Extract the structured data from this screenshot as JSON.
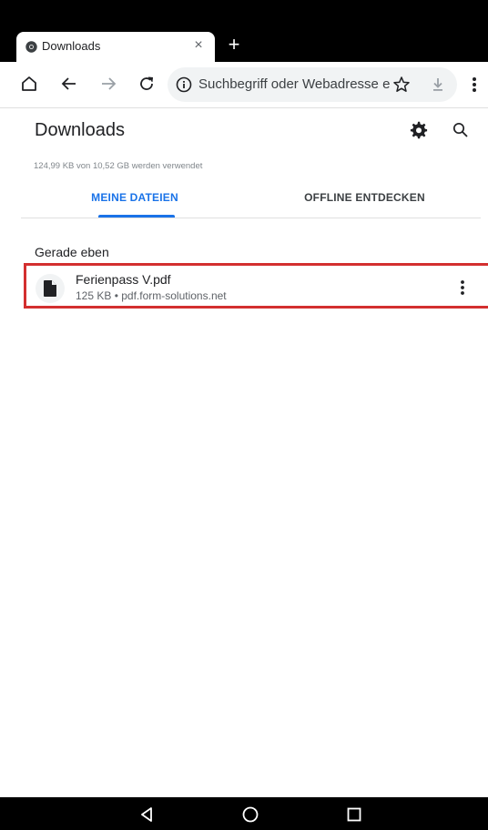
{
  "tab": {
    "title": "Downloads",
    "close_symbol": "×",
    "new_tab_symbol": "+"
  },
  "toolbar": {
    "home_icon": "home-icon",
    "back_icon": "back-arrow-icon",
    "forward_icon": "forward-arrow-icon",
    "reload_icon": "reload-icon",
    "omnibox_text": "Suchbegriff oder Webadresse ei",
    "menu_icon": "more-vert-icon"
  },
  "header": {
    "title": "Downloads",
    "settings_icon": "gear-icon",
    "search_icon": "search-icon",
    "storage": "124,99 KB von 10,52 GB werden verwendet"
  },
  "tabs": [
    {
      "label": "MEINE DATEIEN",
      "active": true
    },
    {
      "label": "OFFLINE ENTDECKEN",
      "active": false
    }
  ],
  "section": {
    "title": "Gerade eben"
  },
  "downloads": [
    {
      "name": "Ferienpass V.pdf",
      "meta": "125 KB • pdf.form-solutions.net",
      "icon": "file-icon"
    }
  ],
  "colors": {
    "accent": "#1a73e8",
    "highlight": "#d32f2f"
  }
}
